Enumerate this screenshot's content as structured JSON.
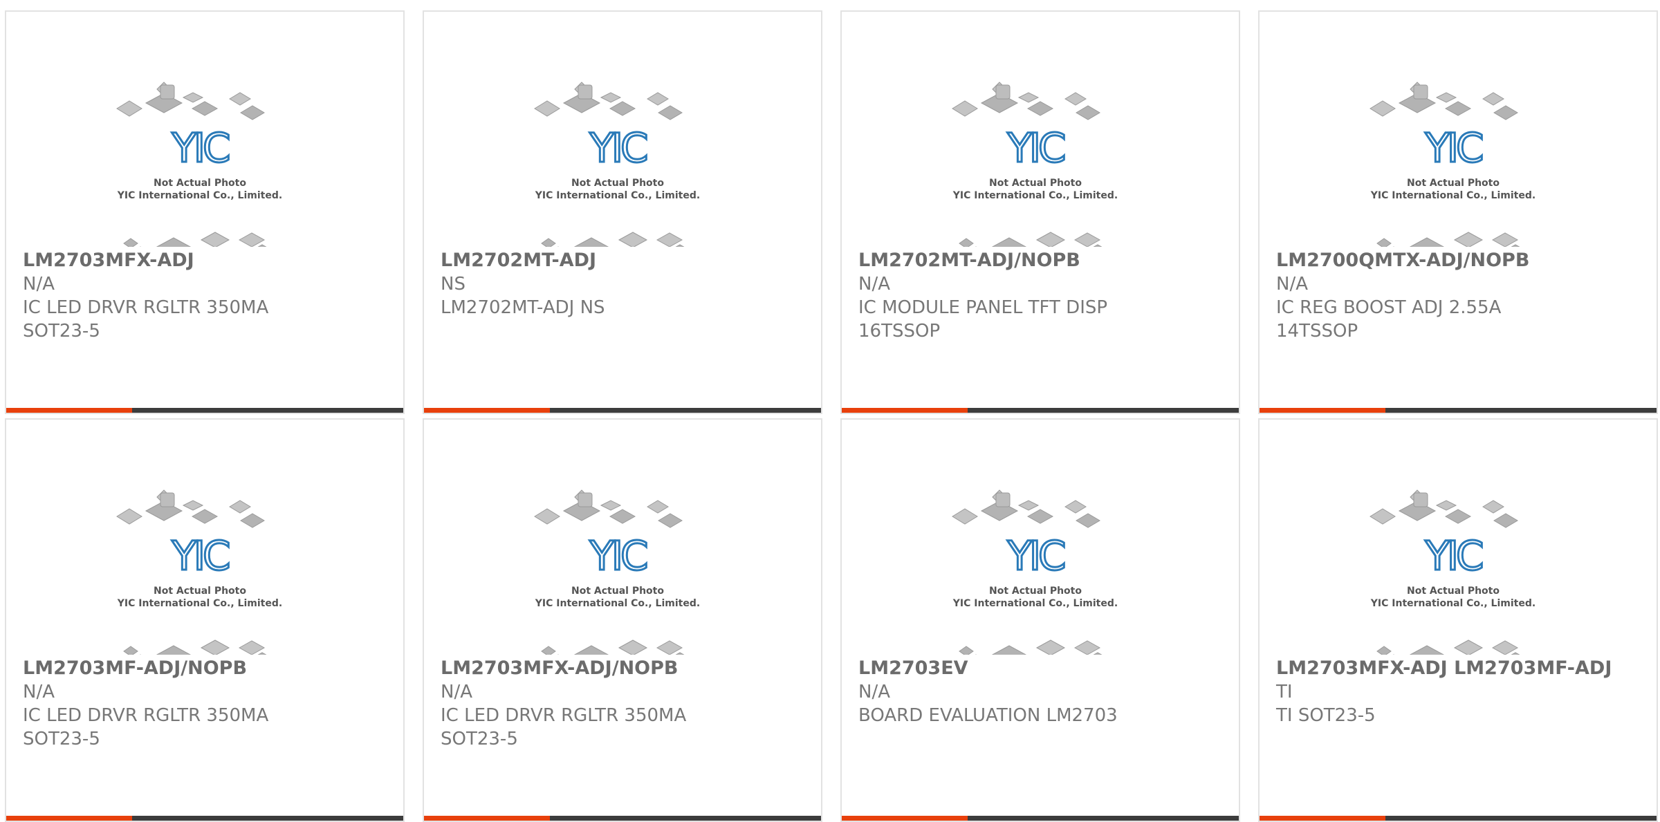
{
  "placeholder_image": {
    "logo_text": "YIC",
    "caption_line1": "Not Actual Photo",
    "caption_line2": "YIC International Co., Limited."
  },
  "colors": {
    "accent": "#e8400c",
    "bar": "#3c3c3c",
    "logo_blue": "#2a7ab8"
  },
  "products": [
    {
      "part_number": "LM2703MFX-ADJ",
      "manufacturer": "N/A",
      "description": "IC LED DRVR RGLTR 350MA SOT23-5"
    },
    {
      "part_number": "LM2702MT-ADJ",
      "manufacturer": "NS",
      "description": "LM2702MT-ADJ NS"
    },
    {
      "part_number": "LM2702MT-ADJ/NOPB",
      "manufacturer": "N/A",
      "description": "IC MODULE PANEL TFT DISP 16TSSOP"
    },
    {
      "part_number": "LM2700QMTX-ADJ/NOPB",
      "manufacturer": "N/A",
      "description": "IC REG BOOST ADJ 2.55A 14TSSOP"
    },
    {
      "part_number": "LM2703MF-ADJ/NOPB",
      "manufacturer": "N/A",
      "description": "IC LED DRVR RGLTR 350MA SOT23-5"
    },
    {
      "part_number": "LM2703MFX-ADJ/NOPB",
      "manufacturer": "N/A",
      "description": "IC LED DRVR RGLTR 350MA SOT23-5"
    },
    {
      "part_number": "LM2703EV",
      "manufacturer": "N/A",
      "description": "BOARD EVALUATION LM2703"
    },
    {
      "part_number": "LM2703MFX-ADJ LM2703MF-ADJ",
      "manufacturer": "TI",
      "description": "TI SOT23-5"
    }
  ]
}
